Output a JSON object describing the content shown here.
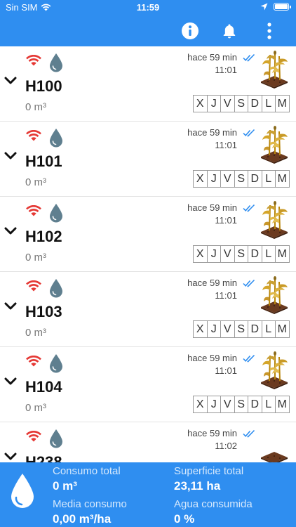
{
  "status_bar": {
    "carrier": "Sin SIM",
    "time": "11:59"
  },
  "app_bar": {
    "info_icon": "info-icon",
    "bell_icon": "bell-icon",
    "menu_icon": "more-vert-icon"
  },
  "colors": {
    "primary": "#2f8ef0",
    "wifi_active": "#e53935",
    "drop": "#5f7f8f",
    "check": "#2f8ef0"
  },
  "rows": [
    {
      "name": "H100",
      "volume": "0 m³",
      "ago": "hace 59 min",
      "time": "11:01",
      "days": [
        "X",
        "J",
        "V",
        "S",
        "D",
        "L",
        "M"
      ]
    },
    {
      "name": "H101",
      "volume": "0 m³",
      "ago": "hace 59 min",
      "time": "11:01",
      "days": [
        "X",
        "J",
        "V",
        "S",
        "D",
        "L",
        "M"
      ]
    },
    {
      "name": "H102",
      "volume": "0 m³",
      "ago": "hace 59 min",
      "time": "11:01",
      "days": [
        "X",
        "J",
        "V",
        "S",
        "D",
        "L",
        "M"
      ]
    },
    {
      "name": "H103",
      "volume": "0 m³",
      "ago": "hace 59 min",
      "time": "11:01",
      "days": [
        "X",
        "J",
        "V",
        "S",
        "D",
        "L",
        "M"
      ]
    },
    {
      "name": "H104",
      "volume": "0 m³",
      "ago": "hace 59 min",
      "time": "11:01",
      "days": [
        "X",
        "J",
        "V",
        "S",
        "D",
        "L",
        "M"
      ]
    },
    {
      "name": "H238",
      "volume": "",
      "ago": "hace 59 min",
      "time": "11:02",
      "days": []
    }
  ],
  "footer": {
    "total_consumption_label": "Consumo total",
    "total_consumption_value": "0 m³",
    "avg_consumption_label": "Media consumo",
    "avg_consumption_value": "0,00 m³/ha",
    "total_area_label": "Superficie total",
    "total_area_value": "23,11 ha",
    "water_used_label": "Agua consumida",
    "water_used_value": "0 %"
  }
}
